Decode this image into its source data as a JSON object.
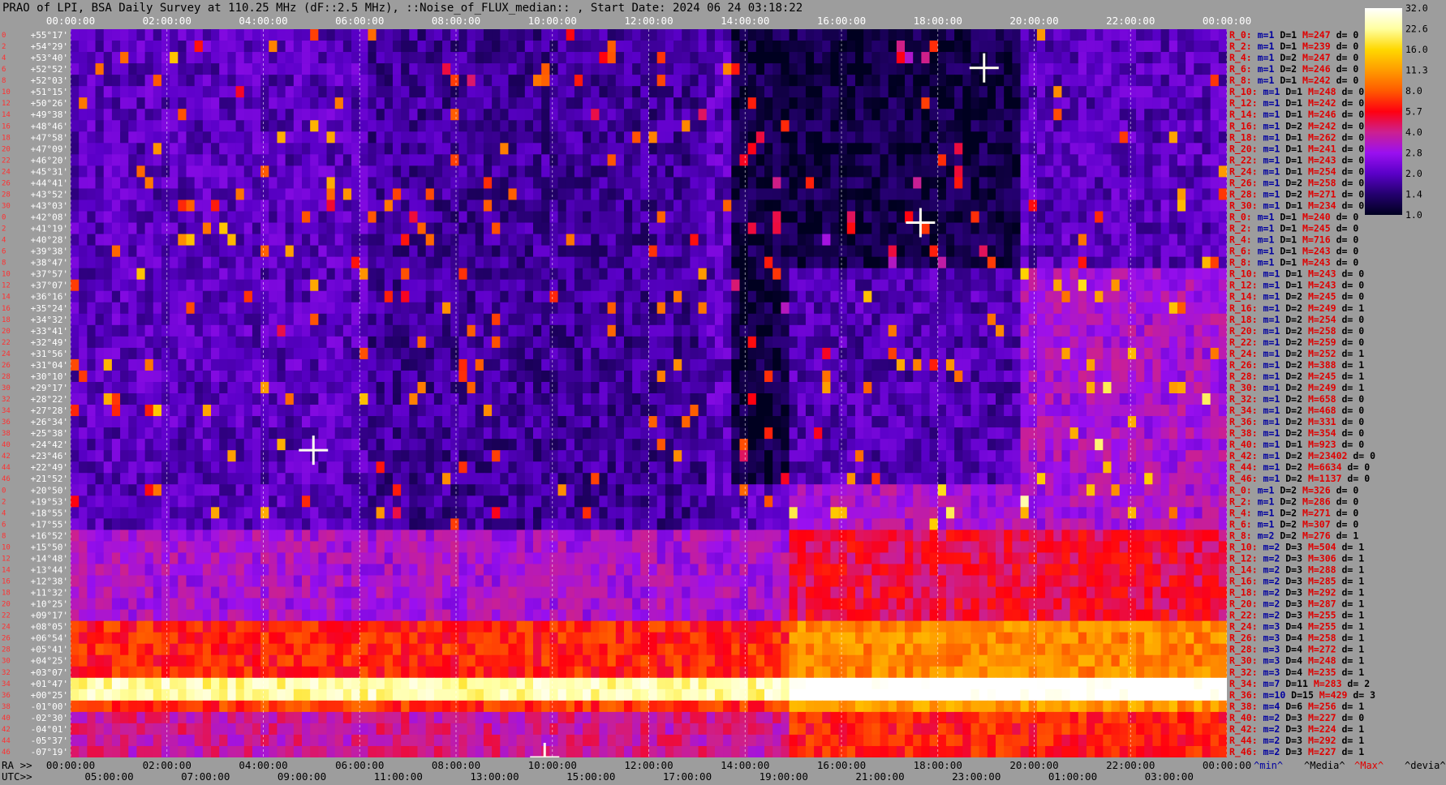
{
  "title": "PRAO of LPI, BSA Daily Survey at 110.25 MHz (dF::2.5 MHz), ::Noise_of_FLUX_median:: , Start Date: 2024 06 24 03:18:22",
  "chart_data": {
    "type": "heatmap",
    "title": "PRAO of LPI, BSA Daily Survey at 110.25 MHz (dF::2.5 MHz), ::Noise_of_FLUX_median:: , Start Date: 2024 06 24 03:18:22",
    "x_axis_top": {
      "label": "",
      "ticks": [
        "00:00:00",
        "02:00:00",
        "04:00:00",
        "06:00:00",
        "08:00:00",
        "10:00:00",
        "12:00:00",
        "14:00:00",
        "16:00:00",
        "18:00:00",
        "20:00:00",
        "22:00:00",
        "00:00:00"
      ]
    },
    "x_axis_bottom_ra": {
      "label": "RA >>",
      "ticks": [
        "00:00:00",
        "02:00:00",
        "04:00:00",
        "06:00:00",
        "08:00:00",
        "10:00:00",
        "12:00:00",
        "14:00:00",
        "16:00:00",
        "18:00:00",
        "20:00:00",
        "22:00:00",
        "00:00:00"
      ]
    },
    "x_axis_bottom_utc": {
      "label": "UTC>>",
      "ticks": [
        "05:00:00",
        "07:00:00",
        "09:00:00",
        "11:00:00",
        "13:00:00",
        "15:00:00",
        "17:00:00",
        "19:00:00",
        "21:00:00",
        "23:00:00",
        "01:00:00",
        "03:00:00"
      ]
    },
    "y_axis": {
      "label": "",
      "ticks": [
        "+55°17'",
        "+54°29'",
        "+53°40'",
        "+52°52'",
        "+52°03'",
        "+51°15'",
        "+50°26'",
        "+49°38'",
        "+48°46'",
        "+47°58'",
        "+47°09'",
        "+46°20'",
        "+45°31'",
        "+44°41'",
        "+43°52'",
        "+43°03'",
        "+42°08'",
        "+41°19'",
        "+40°28'",
        "+39°38'",
        "+38°47'",
        "+37°57'",
        "+37°07'",
        "+36°16'",
        "+35°24'",
        "+34°32'",
        "+33°41'",
        "+32°49'",
        "+31°56'",
        "+31°04'",
        "+30°10'",
        "+29°17'",
        "+28°22'",
        "+27°28'",
        "+26°34'",
        "+25°38'",
        "+24°42'",
        "+23°46'",
        "+22°49'",
        "+21°52'",
        "+20°50'",
        "+19°53'",
        "+18°55'",
        "+17°55'",
        "+16°52'",
        "+15°50'",
        "+14°48'",
        "+13°44'",
        "+12°38'",
        "+11°32'",
        "+10°25'",
        "+09°17'",
        "+08°05'",
        "+06°54'",
        "+05°41'",
        "+04°25'",
        "+03°07'",
        "+01°47'",
        "+00°25'",
        "-01°00'",
        "-02°30'",
        "-04°01'",
        "-05°37'",
        "-07°19'"
      ]
    },
    "colorbar": {
      "ticks": [
        "32.0",
        "22.6",
        "16.0",
        "11.3",
        "8.0",
        "5.7",
        "4.0",
        "2.8",
        "2.0",
        "1.4",
        "1.0"
      ],
      "scale": "log",
      "range": [
        1.0,
        32.0
      ],
      "colormap": [
        "#000020",
        "#24006e",
        "#5a00c8",
        "#9a10f0",
        "#cc2090",
        "#ff0010",
        "#ff5a00",
        "#ff9c00",
        "#ffd800",
        "#ffffa0",
        "#ffffff"
      ]
    },
    "row_stats": [
      {
        "r": "R_0:",
        "m": "m=1",
        "D": "D=1",
        "M": "M=247",
        "d": "d= 0"
      },
      {
        "r": "R_2:",
        "m": "m=1",
        "D": "D=1",
        "M": "M=239",
        "d": "d= 0"
      },
      {
        "r": "R_4:",
        "m": "m=1",
        "D": "D=2",
        "M": "M=247",
        "d": "d= 0"
      },
      {
        "r": "R_6:",
        "m": "m=1",
        "D": "D=2",
        "M": "M=246",
        "d": "d= 0"
      },
      {
        "r": "R_8:",
        "m": "m=1",
        "D": "D=1",
        "M": "M=242",
        "d": "d= 0"
      },
      {
        "r": "R_10:",
        "m": "m=1",
        "D": "D=1",
        "M": "M=248",
        "d": "d= 0"
      },
      {
        "r": "R_12:",
        "m": "m=1",
        "D": "D=1",
        "M": "M=242",
        "d": "d= 0"
      },
      {
        "r": "R_14:",
        "m": "m=1",
        "D": "D=1",
        "M": "M=246",
        "d": "d= 0"
      },
      {
        "r": "R_16:",
        "m": "m=1",
        "D": "D=2",
        "M": "M=242",
        "d": "d= 0"
      },
      {
        "r": "R_18:",
        "m": "m=1",
        "D": "D=1",
        "M": "M=262",
        "d": "d= 0"
      },
      {
        "r": "R_20:",
        "m": "m=1",
        "D": "D=1",
        "M": "M=241",
        "d": "d= 0"
      },
      {
        "r": "R_22:",
        "m": "m=1",
        "D": "D=1",
        "M": "M=243",
        "d": "d= 0"
      },
      {
        "r": "R_24:",
        "m": "m=1",
        "D": "D=1",
        "M": "M=254",
        "d": "d= 0"
      },
      {
        "r": "R_26:",
        "m": "m=1",
        "D": "D=2",
        "M": "M=258",
        "d": "d= 0"
      },
      {
        "r": "R_28:",
        "m": "m=1",
        "D": "D=2",
        "M": "M=271",
        "d": "d= 0"
      },
      {
        "r": "R_30:",
        "m": "m=1",
        "D": "D=1",
        "M": "M=234",
        "d": "d= 0"
      },
      {
        "r": "R_0:",
        "m": "m=1",
        "D": "D=1",
        "M": "M=240",
        "d": "d= 0"
      },
      {
        "r": "R_2:",
        "m": "m=1",
        "D": "D=1",
        "M": "M=245",
        "d": "d= 0"
      },
      {
        "r": "R_4:",
        "m": "m=1",
        "D": "D=1",
        "M": "M=716",
        "d": "d= 0"
      },
      {
        "r": "R_6:",
        "m": "m=1",
        "D": "D=1",
        "M": "M=243",
        "d": "d= 0"
      },
      {
        "r": "R_8:",
        "m": "m=1",
        "D": "D=1",
        "M": "M=243",
        "d": "d= 0"
      },
      {
        "r": "R_10:",
        "m": "m=1",
        "D": "D=1",
        "M": "M=243",
        "d": "d= 0"
      },
      {
        "r": "R_12:",
        "m": "m=1",
        "D": "D=1",
        "M": "M=243",
        "d": "d= 0"
      },
      {
        "r": "R_14:",
        "m": "m=1",
        "D": "D=2",
        "M": "M=245",
        "d": "d= 0"
      },
      {
        "r": "R_16:",
        "m": "m=1",
        "D": "D=2",
        "M": "M=249",
        "d": "d= 1"
      },
      {
        "r": "R_18:",
        "m": "m=1",
        "D": "D=2",
        "M": "M=254",
        "d": "d= 0"
      },
      {
        "r": "R_20:",
        "m": "m=1",
        "D": "D=2",
        "M": "M=258",
        "d": "d= 0"
      },
      {
        "r": "R_22:",
        "m": "m=1",
        "D": "D=2",
        "M": "M=259",
        "d": "d= 0"
      },
      {
        "r": "R_24:",
        "m": "m=1",
        "D": "D=2",
        "M": "M=252",
        "d": "d= 1"
      },
      {
        "r": "R_26:",
        "m": "m=1",
        "D": "D=2",
        "M": "M=388",
        "d": "d= 1"
      },
      {
        "r": "R_28:",
        "m": "m=1",
        "D": "D=2",
        "M": "M=245",
        "d": "d= 1"
      },
      {
        "r": "R_30:",
        "m": "m=1",
        "D": "D=2",
        "M": "M=249",
        "d": "d= 1"
      },
      {
        "r": "R_32:",
        "m": "m=1",
        "D": "D=2",
        "M": "M=658",
        "d": "d= 0"
      },
      {
        "r": "R_34:",
        "m": "m=1",
        "D": "D=2",
        "M": "M=468",
        "d": "d= 0"
      },
      {
        "r": "R_36:",
        "m": "m=1",
        "D": "D=2",
        "M": "M=331",
        "d": "d= 0"
      },
      {
        "r": "R_38:",
        "m": "m=1",
        "D": "D=2",
        "M": "M=354",
        "d": "d= 0"
      },
      {
        "r": "R_40:",
        "m": "m=1",
        "D": "D=1",
        "M": "M=923",
        "d": "d= 0"
      },
      {
        "r": "R_42:",
        "m": "m=1",
        "D": "D=2",
        "M": "M=23402",
        "d": "d= 0"
      },
      {
        "r": "R_44:",
        "m": "m=1",
        "D": "D=2",
        "M": "M=6634",
        "d": "d= 0"
      },
      {
        "r": "R_46:",
        "m": "m=1",
        "D": "D=2",
        "M": "M=1137",
        "d": "d= 0"
      },
      {
        "r": "R_0:",
        "m": "m=1",
        "D": "D=2",
        "M": "M=326",
        "d": "d= 0"
      },
      {
        "r": "R_2:",
        "m": "m=1",
        "D": "D=2",
        "M": "M=286",
        "d": "d= 0"
      },
      {
        "r": "R_4:",
        "m": "m=1",
        "D": "D=2",
        "M": "M=271",
        "d": "d= 0"
      },
      {
        "r": "R_6:",
        "m": "m=1",
        "D": "D=2",
        "M": "M=307",
        "d": "d= 0"
      },
      {
        "r": "R_8:",
        "m": "m=2",
        "D": "D=2",
        "M": "M=276",
        "d": "d= 1"
      },
      {
        "r": "R_10:",
        "m": "m=2",
        "D": "D=3",
        "M": "M=504",
        "d": "d= 1"
      },
      {
        "r": "R_12:",
        "m": "m=2",
        "D": "D=3",
        "M": "M=306",
        "d": "d= 1"
      },
      {
        "r": "R_14:",
        "m": "m=2",
        "D": "D=3",
        "M": "M=288",
        "d": "d= 1"
      },
      {
        "r": "R_16:",
        "m": "m=2",
        "D": "D=3",
        "M": "M=285",
        "d": "d= 1"
      },
      {
        "r": "R_18:",
        "m": "m=2",
        "D": "D=3",
        "M": "M=292",
        "d": "d= 1"
      },
      {
        "r": "R_20:",
        "m": "m=2",
        "D": "D=3",
        "M": "M=287",
        "d": "d= 1"
      },
      {
        "r": "R_22:",
        "m": "m=2",
        "D": "D=3",
        "M": "M=255",
        "d": "d= 1"
      },
      {
        "r": "R_24:",
        "m": "m=3",
        "D": "D=4",
        "M": "M=255",
        "d": "d= 1"
      },
      {
        "r": "R_26:",
        "m": "m=3",
        "D": "D=4",
        "M": "M=258",
        "d": "d= 1"
      },
      {
        "r": "R_28:",
        "m": "m=3",
        "D": "D=4",
        "M": "M=272",
        "d": "d= 1"
      },
      {
        "r": "R_30:",
        "m": "m=3",
        "D": "D=4",
        "M": "M=248",
        "d": "d= 1"
      },
      {
        "r": "R_32:",
        "m": "m=3",
        "D": "D=4",
        "M": "M=235",
        "d": "d= 1"
      },
      {
        "r": "R_34:",
        "m": "m=7",
        "D": "D=11",
        "M": "M=283",
        "d": "d= 2"
      },
      {
        "r": "R_36:",
        "m": "m=10",
        "D": "D=15",
        "M": "M=429",
        "d": "d= 3"
      },
      {
        "r": "R_38:",
        "m": "m=4",
        "D": "D=6",
        "M": "M=256",
        "d": "d= 1"
      },
      {
        "r": "R_40:",
        "m": "m=2",
        "D": "D=3",
        "M": "M=227",
        "d": "d= 0"
      },
      {
        "r": "R_42:",
        "m": "m=2",
        "D": "D=3",
        "M": "M=224",
        "d": "d= 1"
      },
      {
        "r": "R_44:",
        "m": "m=2",
        "D": "D=3",
        "M": "M=292",
        "d": "d= 1"
      },
      {
        "r": "R_46:",
        "m": "m=2",
        "D": "D=3",
        "M": "M=227",
        "d": "d= 1"
      }
    ],
    "row_indices": [
      "0",
      "2",
      "4",
      "6",
      "8",
      "10",
      "12",
      "14",
      "16",
      "18",
      "20",
      "22",
      "24",
      "26",
      "28",
      "30",
      "0",
      "2",
      "4",
      "6",
      "8",
      "10",
      "12",
      "14",
      "16",
      "18",
      "20",
      "22",
      "24",
      "26",
      "28",
      "30",
      "32",
      "34",
      "36",
      "38",
      "40",
      "42",
      "44",
      "46",
      "0",
      "2",
      "4",
      "6",
      "8",
      "10",
      "12",
      "14",
      "16",
      "18",
      "20",
      "22",
      "24",
      "26",
      "28",
      "30",
      "32",
      "34",
      "36",
      "38",
      "40",
      "42",
      "44",
      "46"
    ],
    "stats_legend": [
      "^min^",
      "^Media^",
      "^Max^",
      "^devia^"
    ],
    "colors": {
      "background": "#9d9d9d",
      "tick_text": "#ffffff",
      "stat_blue": "#0000a0",
      "stat_red": "#e00000",
      "plot_base": "#2a0070"
    }
  }
}
